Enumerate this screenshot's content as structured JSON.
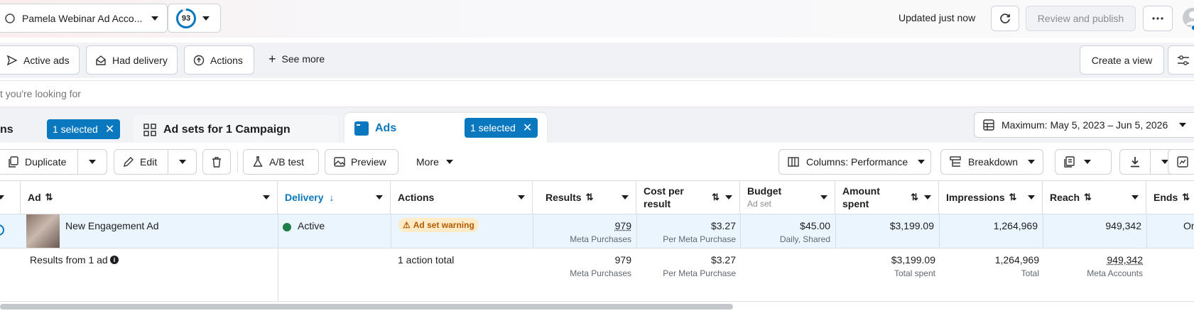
{
  "header": {
    "account_name": "Pamela Webinar Ad Acco...",
    "score": "93",
    "updated_text": "Updated just now",
    "review_label": "Review and publish"
  },
  "filters": {
    "items": [
      "Active ads",
      "Had delivery",
      "Actions"
    ],
    "see_more": "See more",
    "create_view": "Create a view"
  },
  "search": {
    "placeholder": "t you're looking for"
  },
  "tabs": {
    "campaigns_label": "ns",
    "campaigns_selected": "1 selected",
    "adsets_label": "Ad sets for 1 Campaign",
    "ads_label": "Ads",
    "ads_selected": "1 selected",
    "date_range": "Maximum: May 5, 2023 – Jun 5, 2026"
  },
  "toolbar": {
    "duplicate": "Duplicate",
    "edit": "Edit",
    "ab_test": "A/B test",
    "preview": "Preview",
    "more": "More",
    "columns": "Columns: Performance",
    "breakdown": "Breakdown"
  },
  "table": {
    "headers": {
      "ad": "Ad",
      "delivery": "Delivery",
      "actions": "Actions",
      "results": "Results",
      "cost_per_result_1": "Cost per",
      "cost_per_result_2": "result",
      "budget": "Budget",
      "budget_sub": "Ad set",
      "amount_spent_1": "Amount",
      "amount_spent_2": "spent",
      "impressions": "Impressions",
      "reach": "Reach",
      "ends": "Ends"
    },
    "row": {
      "name": "New Engagement Ad",
      "delivery": "Active",
      "warning": "Ad set warning",
      "results": "979",
      "results_sub": "Meta Purchases",
      "cost": "$3.27",
      "cost_sub": "Per Meta Purchase",
      "budget": "$45.00",
      "budget_sub": "Daily, Shared",
      "spent": "$3,199.09",
      "impressions": "1,264,969",
      "reach": "949,342",
      "ends": "On"
    },
    "summary": {
      "label": "Results from 1 ad",
      "actions": "1 action total",
      "results": "979",
      "results_sub": "Meta Purchases",
      "cost": "$3.27",
      "cost_sub": "Per Meta Purchase",
      "spent": "$3,199.09",
      "spent_sub": "Total spent",
      "impressions": "1,264,969",
      "impressions_sub": "Total",
      "reach": "949,342",
      "reach_sub": "Meta Accounts"
    }
  },
  "colors": {
    "accent": "#0a78be",
    "active": "#1e7e4a",
    "warning_bg": "#fdebc8",
    "warning_text": "#b15a00"
  }
}
